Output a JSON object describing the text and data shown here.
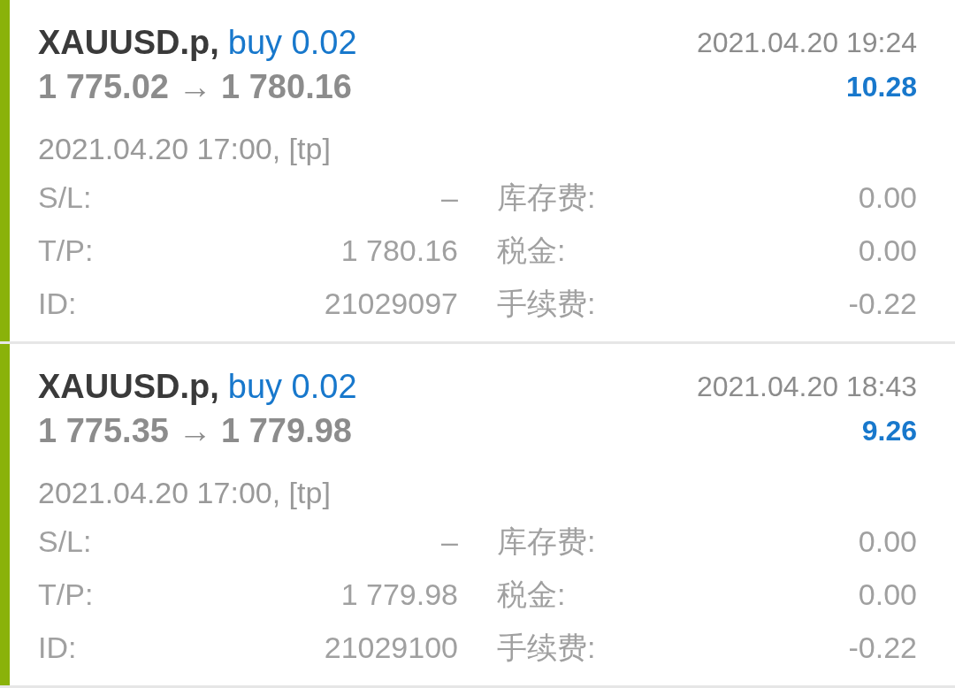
{
  "trades": [
    {
      "symbol": "XAUUSD.p,",
      "side": "buy 0.02",
      "close_time": "2021.04.20 19:24",
      "prices": "1 775.02 → 1 780.16",
      "profit": "10.28",
      "open_time": "2021.04.20 17:00, [tp]",
      "fields": [
        {
          "label": "S/L:",
          "value": "–",
          "label_2": "库存费:",
          "value_2": "0.00"
        },
        {
          "label": "T/P:",
          "value": "1 780.16",
          "label_2": "税金:",
          "value_2": "0.00"
        },
        {
          "label": "ID:",
          "value": "21029097",
          "label_2": "手续费:",
          "value_2": "-0.22"
        }
      ]
    },
    {
      "symbol": "XAUUSD.p,",
      "side": "buy 0.02",
      "close_time": "2021.04.20 18:43",
      "prices": "1 775.35 → 1 779.98",
      "profit": "9.26",
      "open_time": "2021.04.20 17:00, [tp]",
      "fields": [
        {
          "label": "S/L:",
          "value": "–",
          "label_2": "库存费:",
          "value_2": "0.00"
        },
        {
          "label": "T/P:",
          "value": "1 779.98",
          "label_2": "税金:",
          "value_2": "0.00"
        },
        {
          "label": "ID:",
          "value": "21029100",
          "label_2": "手续费:",
          "value_2": "-0.22"
        }
      ]
    }
  ]
}
